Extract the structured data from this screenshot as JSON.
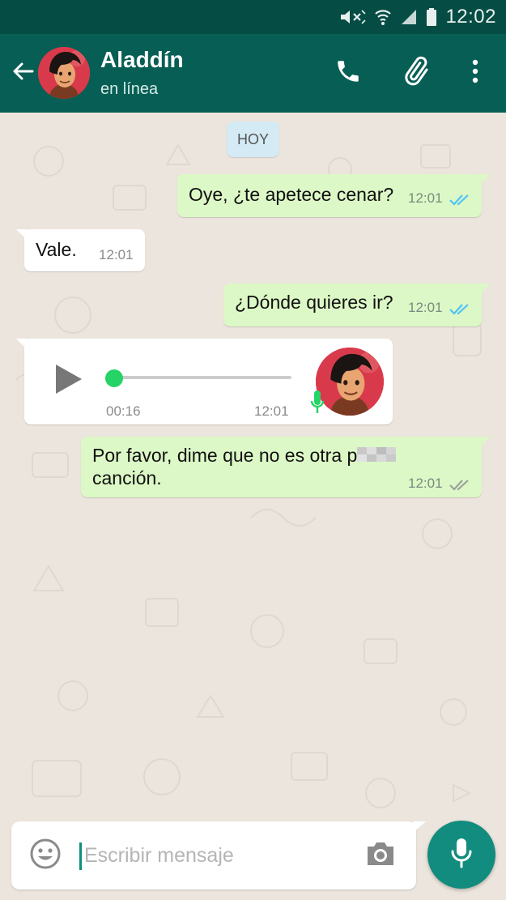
{
  "status_bar": {
    "time": "12:02",
    "icons": [
      "mute-icon",
      "wifi-icon",
      "signal-icon",
      "battery-icon"
    ]
  },
  "header": {
    "contact_name": "Aladdín",
    "contact_status": "en línea",
    "icons": [
      "back-arrow-icon",
      "avatar",
      "phone-icon",
      "paperclip-icon",
      "more-vert-icon"
    ]
  },
  "chat": {
    "date_chip": "HOY",
    "messages": [
      {
        "direction": "out",
        "text": "Oye, ¿te apetece cenar?",
        "time": "12:01",
        "status": "read"
      },
      {
        "direction": "in",
        "text": "Vale.",
        "time": "12:01"
      },
      {
        "direction": "out",
        "text": "¿Dónde quieres ir?",
        "time": "12:01",
        "status": "read"
      },
      {
        "direction": "in",
        "type": "voice",
        "duration": "00:16",
        "time": "12:01",
        "progress": 0.0
      },
      {
        "direction": "out",
        "text_line1": "Por favor, dime que no es otra p",
        "text_line2": "canción.",
        "time": "12:01",
        "status": "delivered"
      }
    ]
  },
  "composer": {
    "placeholder": "Escribir mensaje",
    "value": ""
  },
  "colors": {
    "header": "#075e54",
    "status_bar": "#054d44",
    "outgoing_bubble": "#dcf8c6",
    "incoming_bubble": "#ffffff",
    "read_ticks": "#4fc3f7",
    "fab": "#128c7e",
    "background": "#ece5dd"
  }
}
